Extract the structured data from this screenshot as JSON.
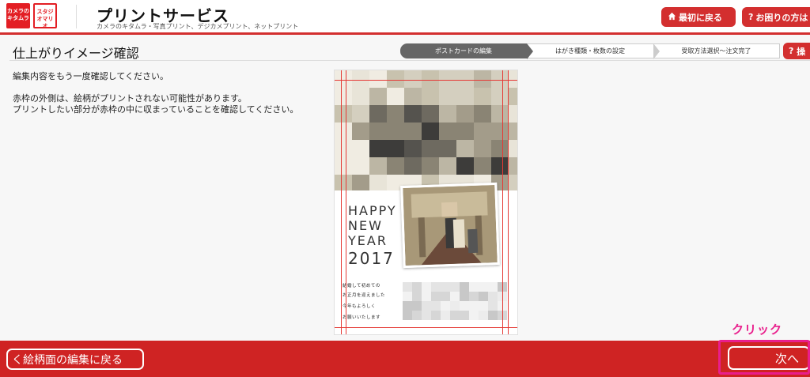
{
  "header": {
    "logo_primary": "カメラのキタムラ",
    "logo_secondary": "スタジオマリオ",
    "app_title": "プリントサービス",
    "app_subtitle": "カメラのキタムラ・写真プリント、デジカメプリント、ネットプリント",
    "home_button": "最初に戻る",
    "help_button": "お困りの方は",
    "home_icon": "home-icon",
    "help_icon": "question-icon"
  },
  "page": {
    "title": "仕上がりイメージ確認",
    "help_short": "操",
    "steps": [
      {
        "label": "ポストカードの編集",
        "active": true
      },
      {
        "label": "はがき種類・枚数の設定",
        "active": false
      },
      {
        "label": "受取方法選択〜注文完了",
        "active": false
      }
    ],
    "instructions": [
      "編集内容をもう一度確認してください。",
      "赤枠の外側は、絵柄がプリントされない可能性があります。",
      "プリントしたい部分が赤枠の中に収まっていることを確認してください。"
    ]
  },
  "postcard": {
    "greeting_lines": [
      "HAPPY",
      "NEW",
      "YEAR",
      "2017"
    ],
    "message_lines": [
      "結婚して初めての",
      "お正月を迎えました",
      "今年もよろしく",
      "お願いいたします"
    ],
    "safe_area_color": "#e53935"
  },
  "footer": {
    "back_button": "く絵柄面の編集に戻る",
    "next_button": "次へ",
    "annotation": "クリック",
    "annotation_color": "#e91e8c"
  }
}
